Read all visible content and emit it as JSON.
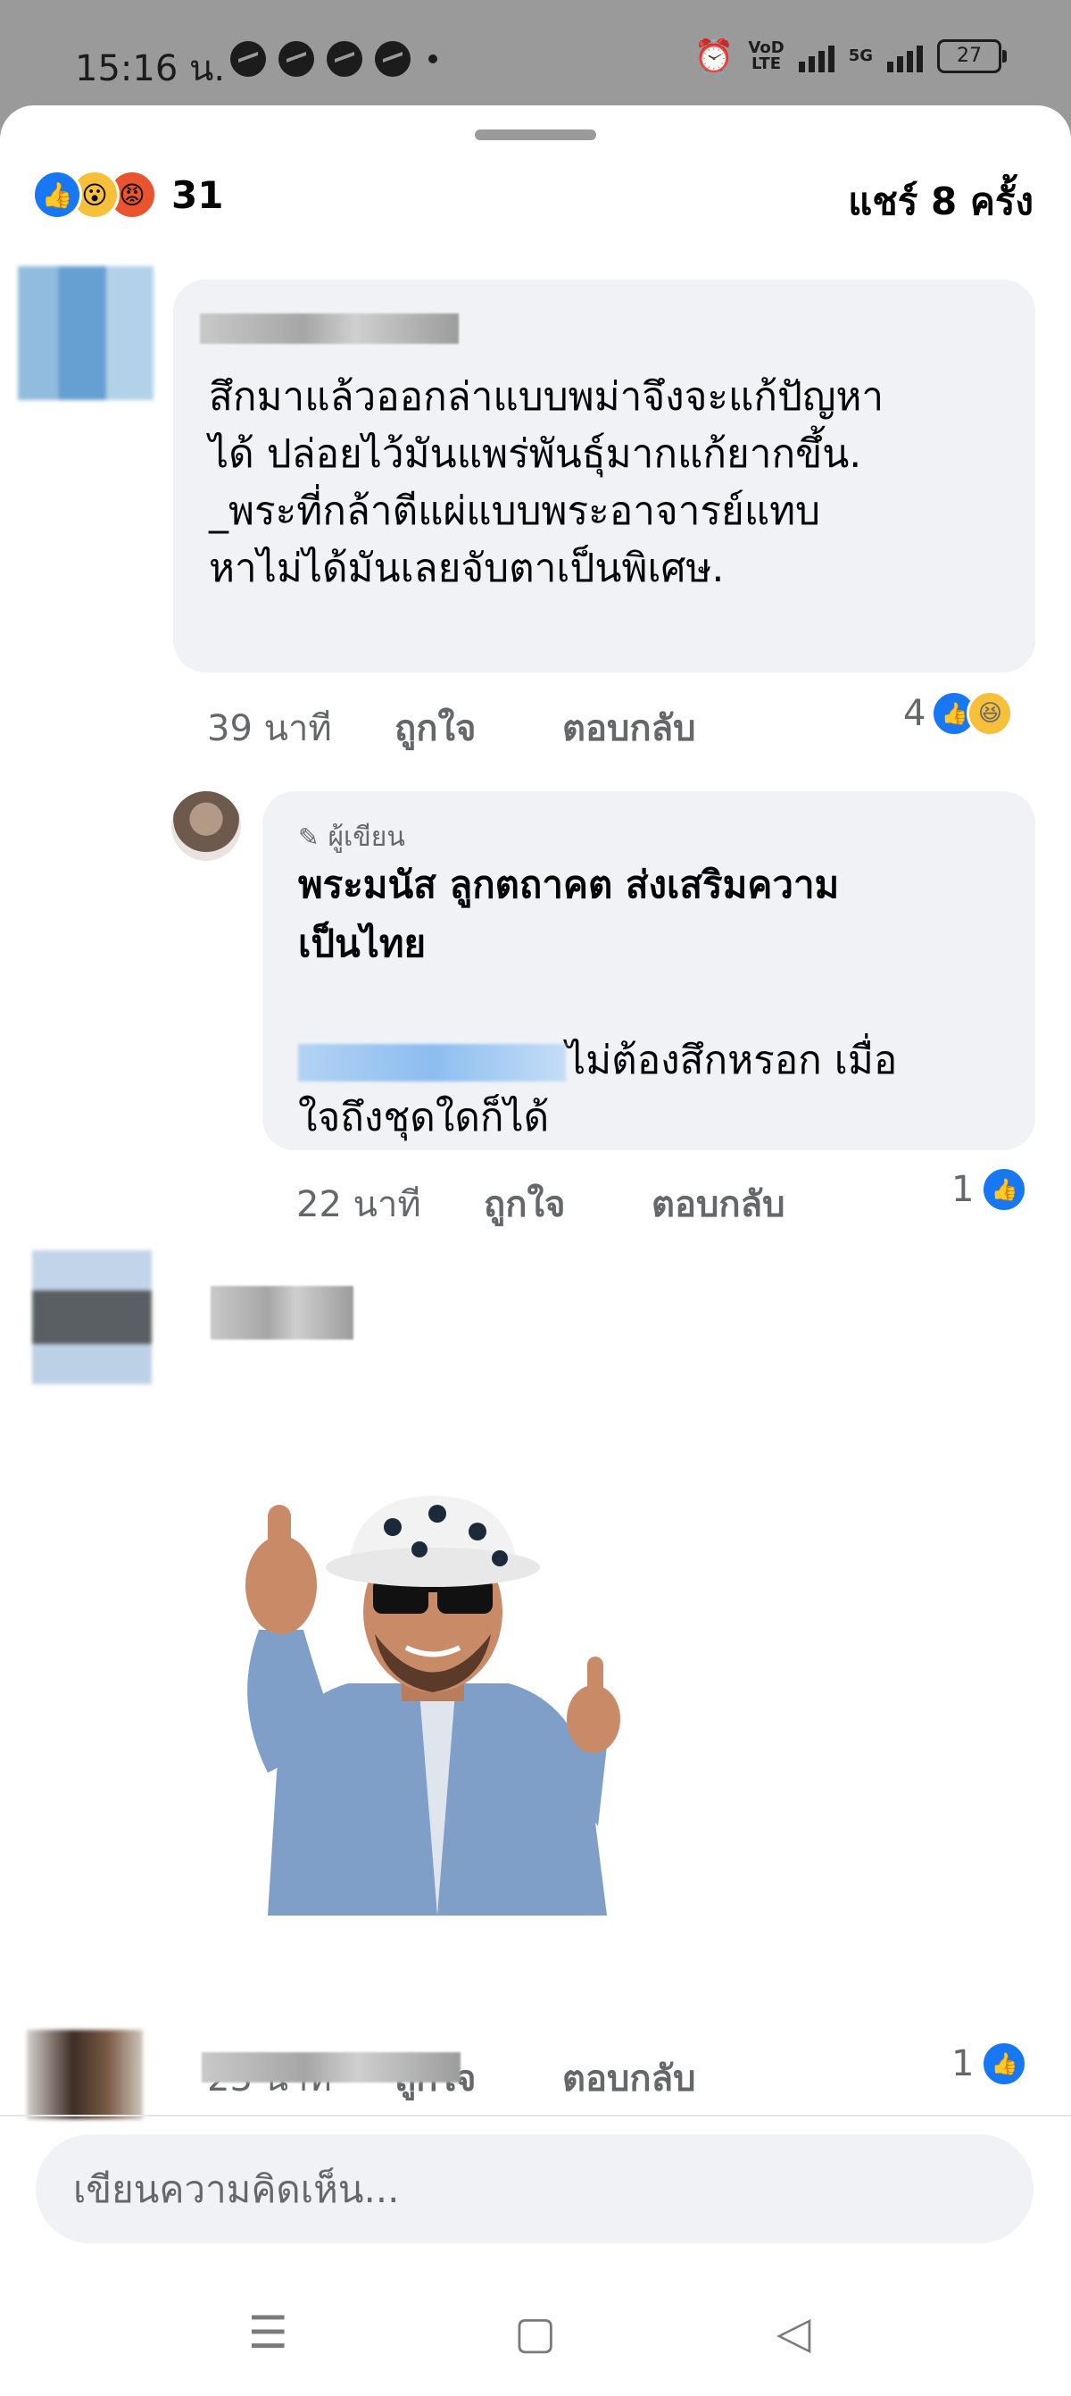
{
  "status_bar": {
    "time": "15:16 น.",
    "network_label_top": "VoD",
    "network_label_bottom": "LTE",
    "signal_label": "5G",
    "battery": "27"
  },
  "summary": {
    "reaction_count": "31",
    "reactions": [
      "like-icon",
      "wow-icon",
      "angry-icon"
    ],
    "shares": "แชร์ 8 ครั้ง"
  },
  "comments": [
    {
      "text": "สึกมาแล้วออกล่าแบบพม่าจึงจะแก้ปัญหา\nได้ ปล่อยไว้มันแพร่พันธุ์มากแก้ยากขึ้น.\n_พระที่กล้าตีแผ่แบบพระอาจารย์แทบ\nหาไม่ได้มันเลยจับตาเป็นพิเศษ.",
      "time": "39 นาที",
      "like": "ถูกใจ",
      "reply": "ตอบกลับ",
      "reaction_count": "4"
    },
    {
      "author_tag": "ผู้เขียน",
      "name": "พระมนัส ลูกตถาคต ส่งเสริมความ\nเป็นไทย",
      "text": "ไม่ต้องสึกหรอก เมื่อ\nใจถึงชุดใดก็ได้",
      "time": "22 นาที",
      "like": "ถูกใจ",
      "reply": "ตอบกลับ",
      "reaction_count": "1"
    },
    {
      "time": "23 นาที",
      "like": "ถูกใจ",
      "reply": "ตอบกลับ",
      "reaction_count": "1"
    }
  ],
  "composer": {
    "placeholder": "เขียนความคิดเห็น..."
  },
  "colors": {
    "facebook_blue": "#1877f2",
    "bubble_bg": "#f0f2f5",
    "meta_gray": "#65676b"
  }
}
